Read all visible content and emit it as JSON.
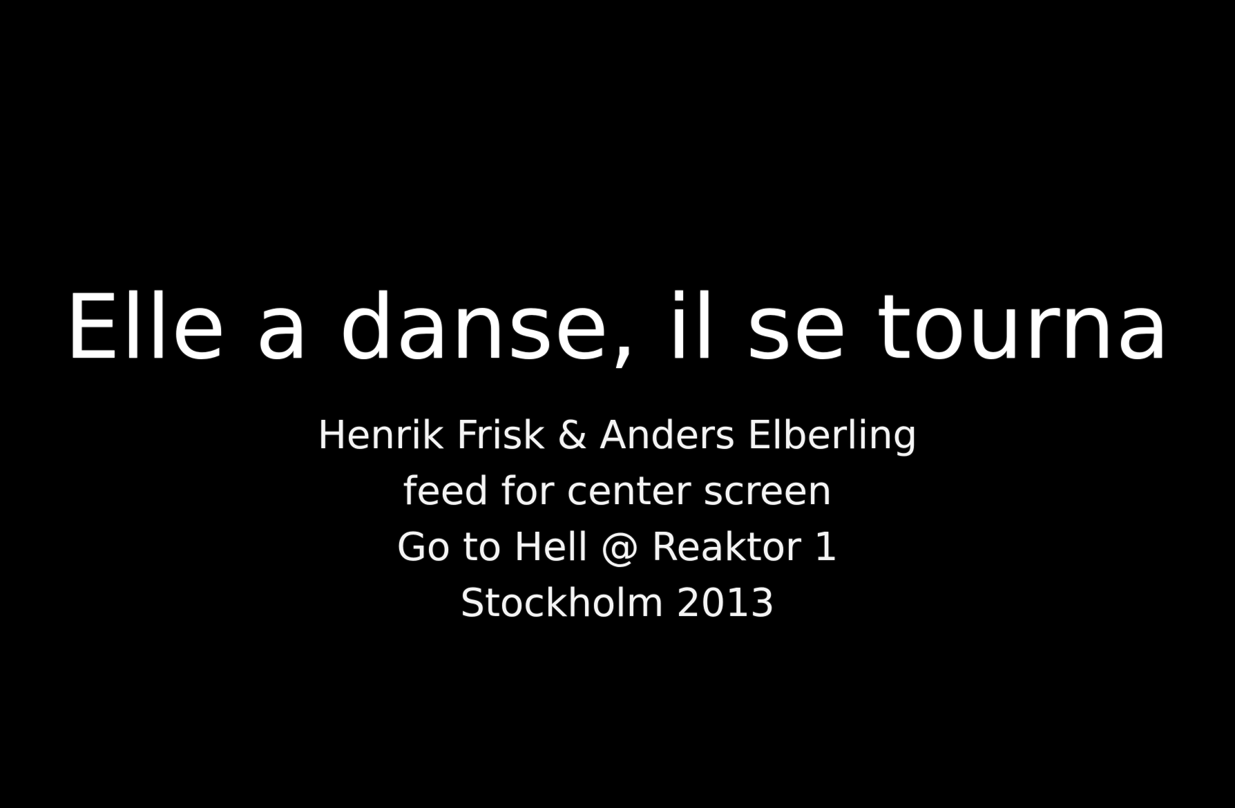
{
  "title": "Elle a danse, il se tourna",
  "credits": [
    "Henrik Frisk & Anders Elberling",
    "feed for center screen",
    "Go to Hell @ Reaktor 1",
    "Stockholm 2013"
  ],
  "colors": {
    "background": "#000000",
    "text": "#ffffff"
  }
}
